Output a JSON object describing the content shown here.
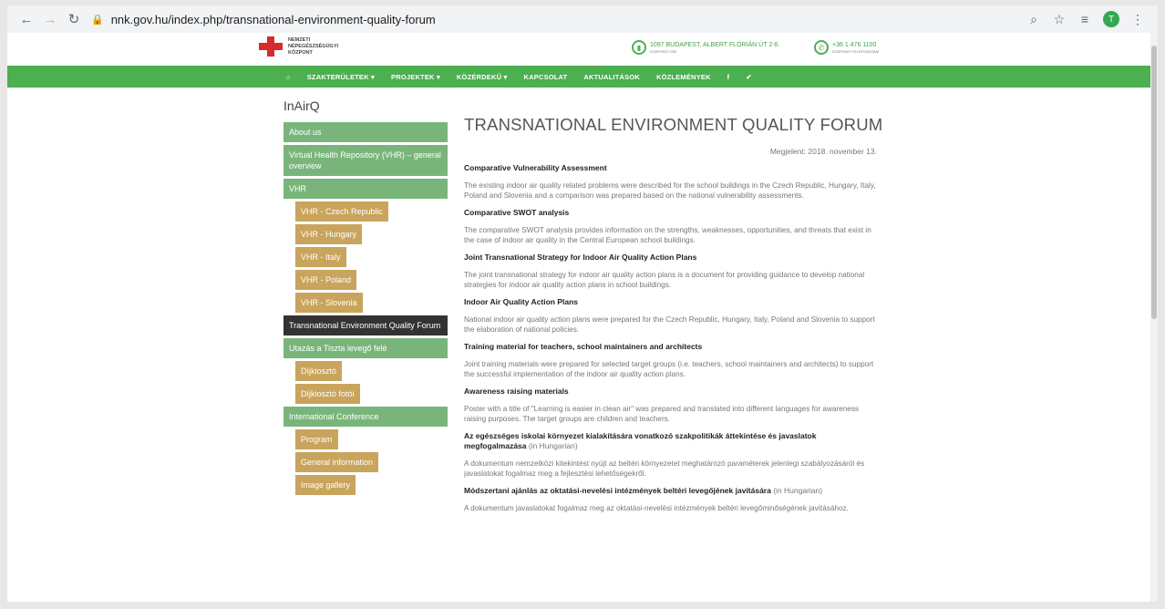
{
  "browser": {
    "url": "nnk.gov.hu/index.php/transnational-environment-quality-forum",
    "avatar_letter": "T"
  },
  "site": {
    "logo_lines": [
      "NEMZETI",
      "NÉPEGÉSZSÉGÜGYI",
      "KÖZPONT"
    ],
    "address": "1097 BUDAPEST, ALBERT FLÓRIÁN ÚT 2-6.",
    "address_sub": "KÖZPONTI CÍM",
    "phone": "+36 1 476 1100",
    "phone_sub": "KÖZPONTI TELEFONSZÁM",
    "brand_color": "#4caf50"
  },
  "nav": {
    "home_icon": "home-icon",
    "items": [
      "SZAKTERÜLETEK",
      "PROJEKTEK",
      "KÖZÉRDEKŰ",
      "KAPCSOLAT",
      "AKTUALITÁSOK",
      "KÖZLEMÉNYEK"
    ]
  },
  "sidebar": {
    "title": "InAirQ",
    "items": [
      {
        "label": "About us",
        "style": "green"
      },
      {
        "label": "Virtual Health Repository (VHR) – general overview",
        "style": "green"
      },
      {
        "label": "VHR",
        "style": "green"
      },
      {
        "label": "VHR - Czech Republic",
        "style": "gold"
      },
      {
        "label": "VHR - Hungary",
        "style": "gold"
      },
      {
        "label": "VHR - Italy",
        "style": "gold"
      },
      {
        "label": "VHR - Poland",
        "style": "gold"
      },
      {
        "label": "VHR - Slovenia",
        "style": "gold"
      },
      {
        "label": "Transnational Environment Quality Forum",
        "style": "dark"
      },
      {
        "label": "Utazás a Tiszta levegő felé",
        "style": "green"
      },
      {
        "label": "Díjkiosztó",
        "style": "gold"
      },
      {
        "label": "Díjkiosztó fotói",
        "style": "gold"
      },
      {
        "label": "International Conference",
        "style": "green"
      },
      {
        "label": "Program",
        "style": "gold"
      },
      {
        "label": "General information",
        "style": "gold"
      },
      {
        "label": "Image gallery",
        "style": "gold"
      }
    ]
  },
  "content": {
    "title": "TRANSNATIONAL ENVIRONMENT QUALITY FORUM",
    "date": "Megjelent: 2018. november 13.",
    "sections": [
      {
        "heading": "Comparative Vulnerability Assessment",
        "suffix": "",
        "text": "The existing indoor air quality related problems were described for the school buildings in the Czech Republic, Hungary, Italy, Poland and Slovenia and a comparison was prepared based on the national vulnerability assessments."
      },
      {
        "heading": "Comparative SWOT analysis",
        "suffix": "",
        "text": "The comparative SWOT analysis provides information on the strengths, weaknesses, opportunities, and threats that exist in the case of indoor air quality in the Central European school buildings."
      },
      {
        "heading": "Joint Transnational Strategy for Indoor Air Quality Action Plans",
        "suffix": "",
        "text": "The joint transnational strategy for indoor air quality action plans is a document for providing guidance to develop national strategies for indoor air quality action plans in school buildings."
      },
      {
        "heading": "Indoor Air Quality Action Plans",
        "suffix": "",
        "text": "National indoor air quality action plans were prepared for the Czech Republic, Hungary, Italy, Poland and Slovenia to support the elaboration of national policies."
      },
      {
        "heading": "Training material for teachers, school maintainers and architects",
        "suffix": "",
        "text": "Joint training materials were prepared for selected target groups (i.e. teachers, school maintainers and architects) to support the successful implementation of the indoor air quality action plans."
      },
      {
        "heading": "Awareness raising materials",
        "suffix": "",
        "text": "Poster with a title of \"Learning is easier in clean air\" was prepared and translated into different languages for awareness raising purposes. The target groups are children and teachers."
      },
      {
        "heading": "Az egészséges iskolai környezet kialakítására vonatkozó szakpolitikák áttekintése és javaslatok megfogalmazása",
        "suffix": " (in Hungarian)",
        "text": "A dokumentum nemzetközi kitekintést nyújt az beltéri környezetet meghatározó paraméterek jelenlegi szabályozásáról és javaslatokat fogalmaz meg a fejlesztési lehetőségekről."
      },
      {
        "heading": "Módszertani ajánlás az oktatási-nevelési intézmények beltéri levegőjének javítására",
        "suffix": " (in Hungarian)",
        "text": "A dokumentum javaslatokat fogalmaz meg az oktatási-nevelési intézmények beltéri levegőminőségének javításához."
      }
    ]
  }
}
